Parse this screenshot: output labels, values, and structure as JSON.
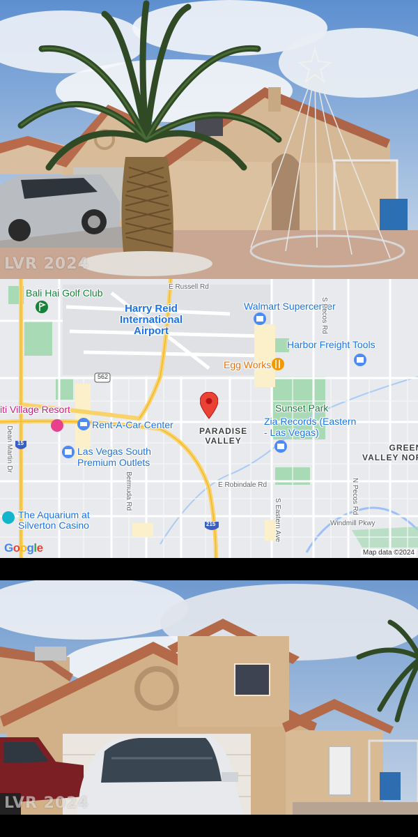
{
  "watermark_text": "LVR 2024",
  "photo_top": {
    "description_icon": "house-front-with-palm-tree"
  },
  "photo_bottom": {
    "description_icon": "house-front-with-truck"
  },
  "map": {
    "pois": [
      {
        "id": "bali-hai",
        "label": "Bali Hai Golf Club",
        "style": "green"
      },
      {
        "id": "airport",
        "label_line1": "Harry Reid",
        "label_line2": "International",
        "label_line3": "Airport",
        "style": "airport"
      },
      {
        "id": "walmart",
        "label": "Walmart Supercenter",
        "style": "blue"
      },
      {
        "id": "harbor",
        "label": "Harbor Freight Tools",
        "style": "blue"
      },
      {
        "id": "eggworks",
        "label": "Egg Works",
        "style": "orange"
      },
      {
        "id": "tahiti",
        "label": "iti Village Resort",
        "style": "pink"
      },
      {
        "id": "rentacar",
        "label": "Rent-A-Car Center",
        "style": "blue"
      },
      {
        "id": "sunset",
        "label": "Sunset Park",
        "style": "green"
      },
      {
        "id": "zia",
        "label_line1": "Zia Records (Eastern",
        "label_line2": "- Las Vegas)",
        "style": "blue"
      },
      {
        "id": "lvsouth",
        "label_line1": "Las Vegas South",
        "label_line2": "Premium Outlets",
        "style": "blue"
      },
      {
        "id": "aquarium",
        "label_line1": "The Aquarium at",
        "label_line2": "Silverton Casino",
        "style": "blue"
      }
    ],
    "areas": {
      "paradise_line1": "PARADISE",
      "paradise_line2": "VALLEY",
      "green_valley": "GREEN",
      "green_valley2": "VALLEY NOR"
    },
    "roads": {
      "russell": "E Russell Rd",
      "specos": "S Pecos Rd",
      "npecos": "N Pecos Rd",
      "robindale": "E Robindale Rd",
      "seastern": "S Eastern Ave",
      "bermuda": "Bermuda Rd",
      "deanmartin": "Dean Martin Dr",
      "windmill": "Windmill Pkwy",
      "r562": "562",
      "i15": "15",
      "i215": "215"
    },
    "google": [
      "G",
      "o",
      "o",
      "g",
      "l",
      "e"
    ],
    "google_colors": [
      "#4285f4",
      "#ea4335",
      "#fbbc05",
      "#4285f4",
      "#34a853",
      "#ea4335"
    ],
    "attribution": "Map data ©2024"
  }
}
